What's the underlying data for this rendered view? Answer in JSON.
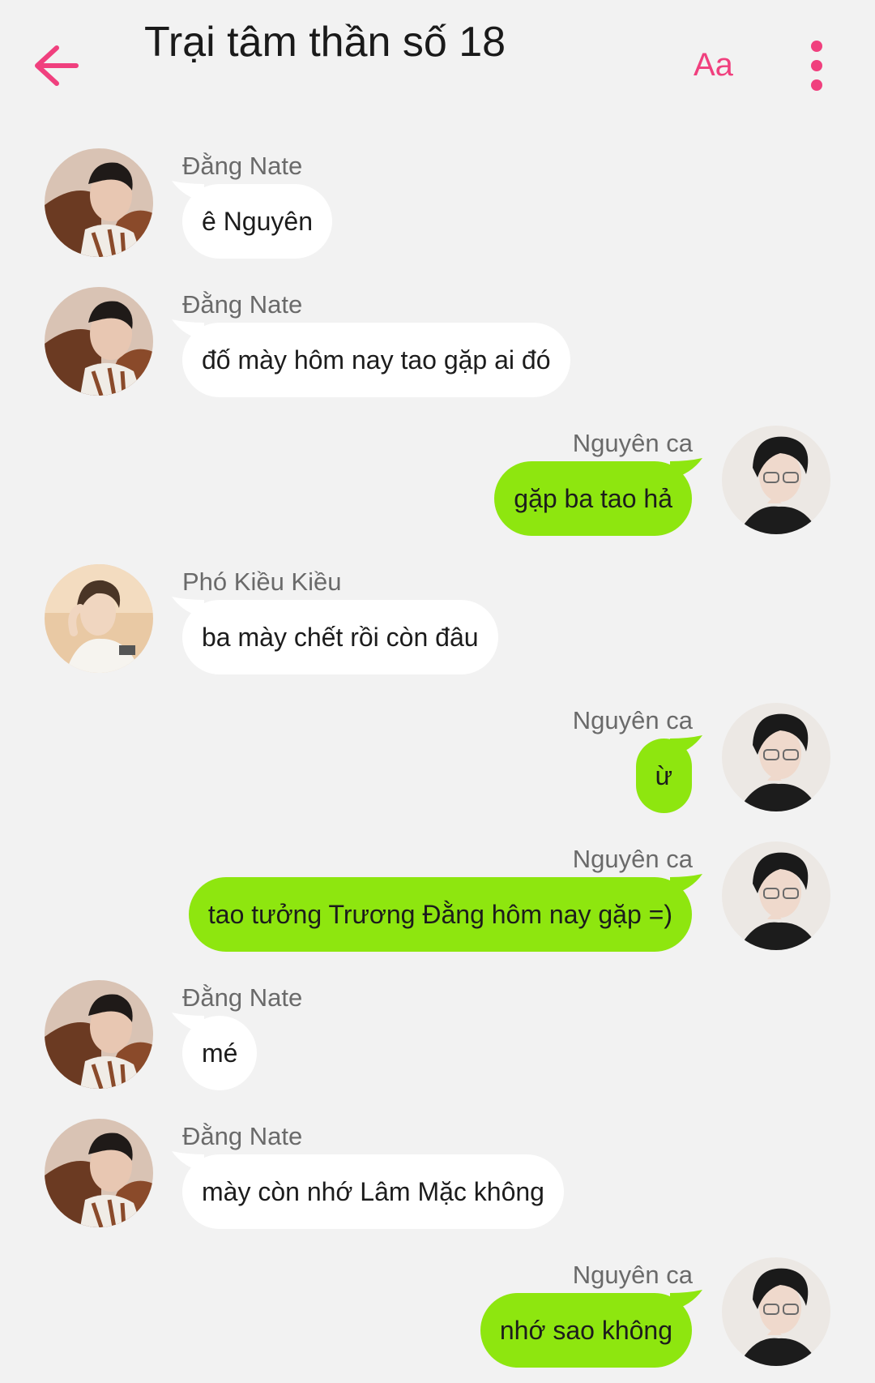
{
  "header": {
    "title": "Trại tâm thần số 18",
    "font_button_label": "Aa",
    "back_icon": "arrow-left-icon",
    "menu_icon": "more-vertical-icon",
    "accent_color": "#f0407e"
  },
  "colors": {
    "background": "#f2f2f2",
    "incoming_bubble": "#ffffff",
    "outgoing_bubble": "#8ee60f"
  },
  "messages": [
    {
      "sender": "Đằng Nate",
      "text": "ê Nguyên",
      "side": "left"
    },
    {
      "sender": "Đằng Nate",
      "text": "đố mày hôm nay tao gặp ai đó",
      "side": "left"
    },
    {
      "sender": "Nguyên ca",
      "text": "gặp ba tao hả",
      "side": "right"
    },
    {
      "sender": "Phó Kiều Kiều",
      "text": "ba mày chết rồi còn đâu",
      "side": "left"
    },
    {
      "sender": "Nguyên ca",
      "text": "ừ",
      "side": "right"
    },
    {
      "sender": "Nguyên ca",
      "text": "tao tưởng Trương Đằng hôm nay gặp =)",
      "side": "right"
    },
    {
      "sender": "Đằng Nate",
      "text": "mé",
      "side": "left"
    },
    {
      "sender": "Đằng Nate",
      "text": "mày còn nhớ Lâm Mặc không",
      "side": "left"
    },
    {
      "sender": "Nguyên ca",
      "text": "nhớ sao không",
      "side": "right"
    }
  ]
}
